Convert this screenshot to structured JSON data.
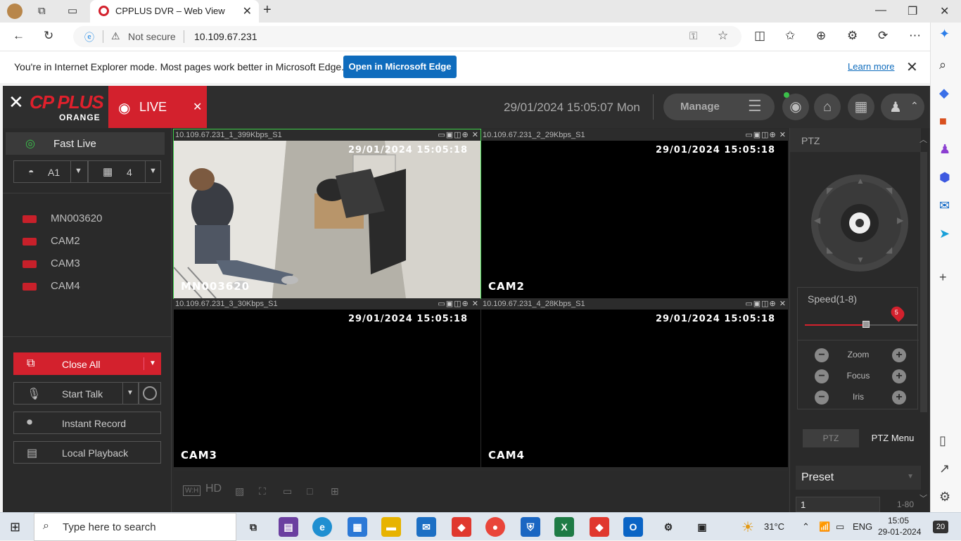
{
  "browser": {
    "tab_title": "CPPLUS DVR – Web View",
    "security_label": "Not secure",
    "url": "10.109.67.231",
    "ie_banner": {
      "message": "You're in Internet Explorer mode. Most pages work better in Microsoft Edge.",
      "open_button": "Open in Microsoft Edge",
      "learn_more": "Learn more"
    }
  },
  "dvr": {
    "logo_text": "CP PLUS",
    "logo_sub": "ORANGE",
    "live_tab": "LIVE",
    "datetime": "29/01/2024 15:05:07 Mon",
    "manage_label": "Manage",
    "left_panel": {
      "fast_live": "Fast Live",
      "select_a": "A1",
      "select_layout": "4",
      "cameras": [
        "MN003620",
        "CAM2",
        "CAM3",
        "CAM4"
      ],
      "close_all": "Close All",
      "start_talk": "Start Talk",
      "instant_record": "Instant Record",
      "local_playback": "Local Playback"
    },
    "cells": [
      {
        "header": "10.109.67.231_1_399Kbps_S1",
        "timestamp": "29/01/2024 15:05:18",
        "name": "MN003620"
      },
      {
        "header": "10.109.67.231_2_29Kbps_S1",
        "timestamp": "29/01/2024 15:05:18",
        "name": "CAM2"
      },
      {
        "header": "10.109.67.231_3_30Kbps_S1",
        "timestamp": "29/01/2024 15:05:18",
        "name": "CAM3"
      },
      {
        "header": "10.109.67.231_4_28Kbps_S1",
        "timestamp": "29/01/2024 15:05:18",
        "name": "CAM4"
      }
    ],
    "bottom_bar": {
      "wh": "W:H",
      "hd": "HD"
    },
    "ptz": {
      "title": "PTZ",
      "speed_label": "Speed(1-8)",
      "speed_value": "5",
      "zoom": "Zoom",
      "focus": "Focus",
      "iris": "Iris",
      "tab_ptz": "PTZ",
      "tab_menu": "PTZ Menu",
      "preset_label": "Preset",
      "preset_value": "1",
      "preset_range": "1-80"
    }
  },
  "taskbar": {
    "search_placeholder": "Type here to search",
    "weather": "31°C",
    "language": "ENG",
    "time": "15:05",
    "date": "29-01-2024",
    "notifications": "20"
  }
}
